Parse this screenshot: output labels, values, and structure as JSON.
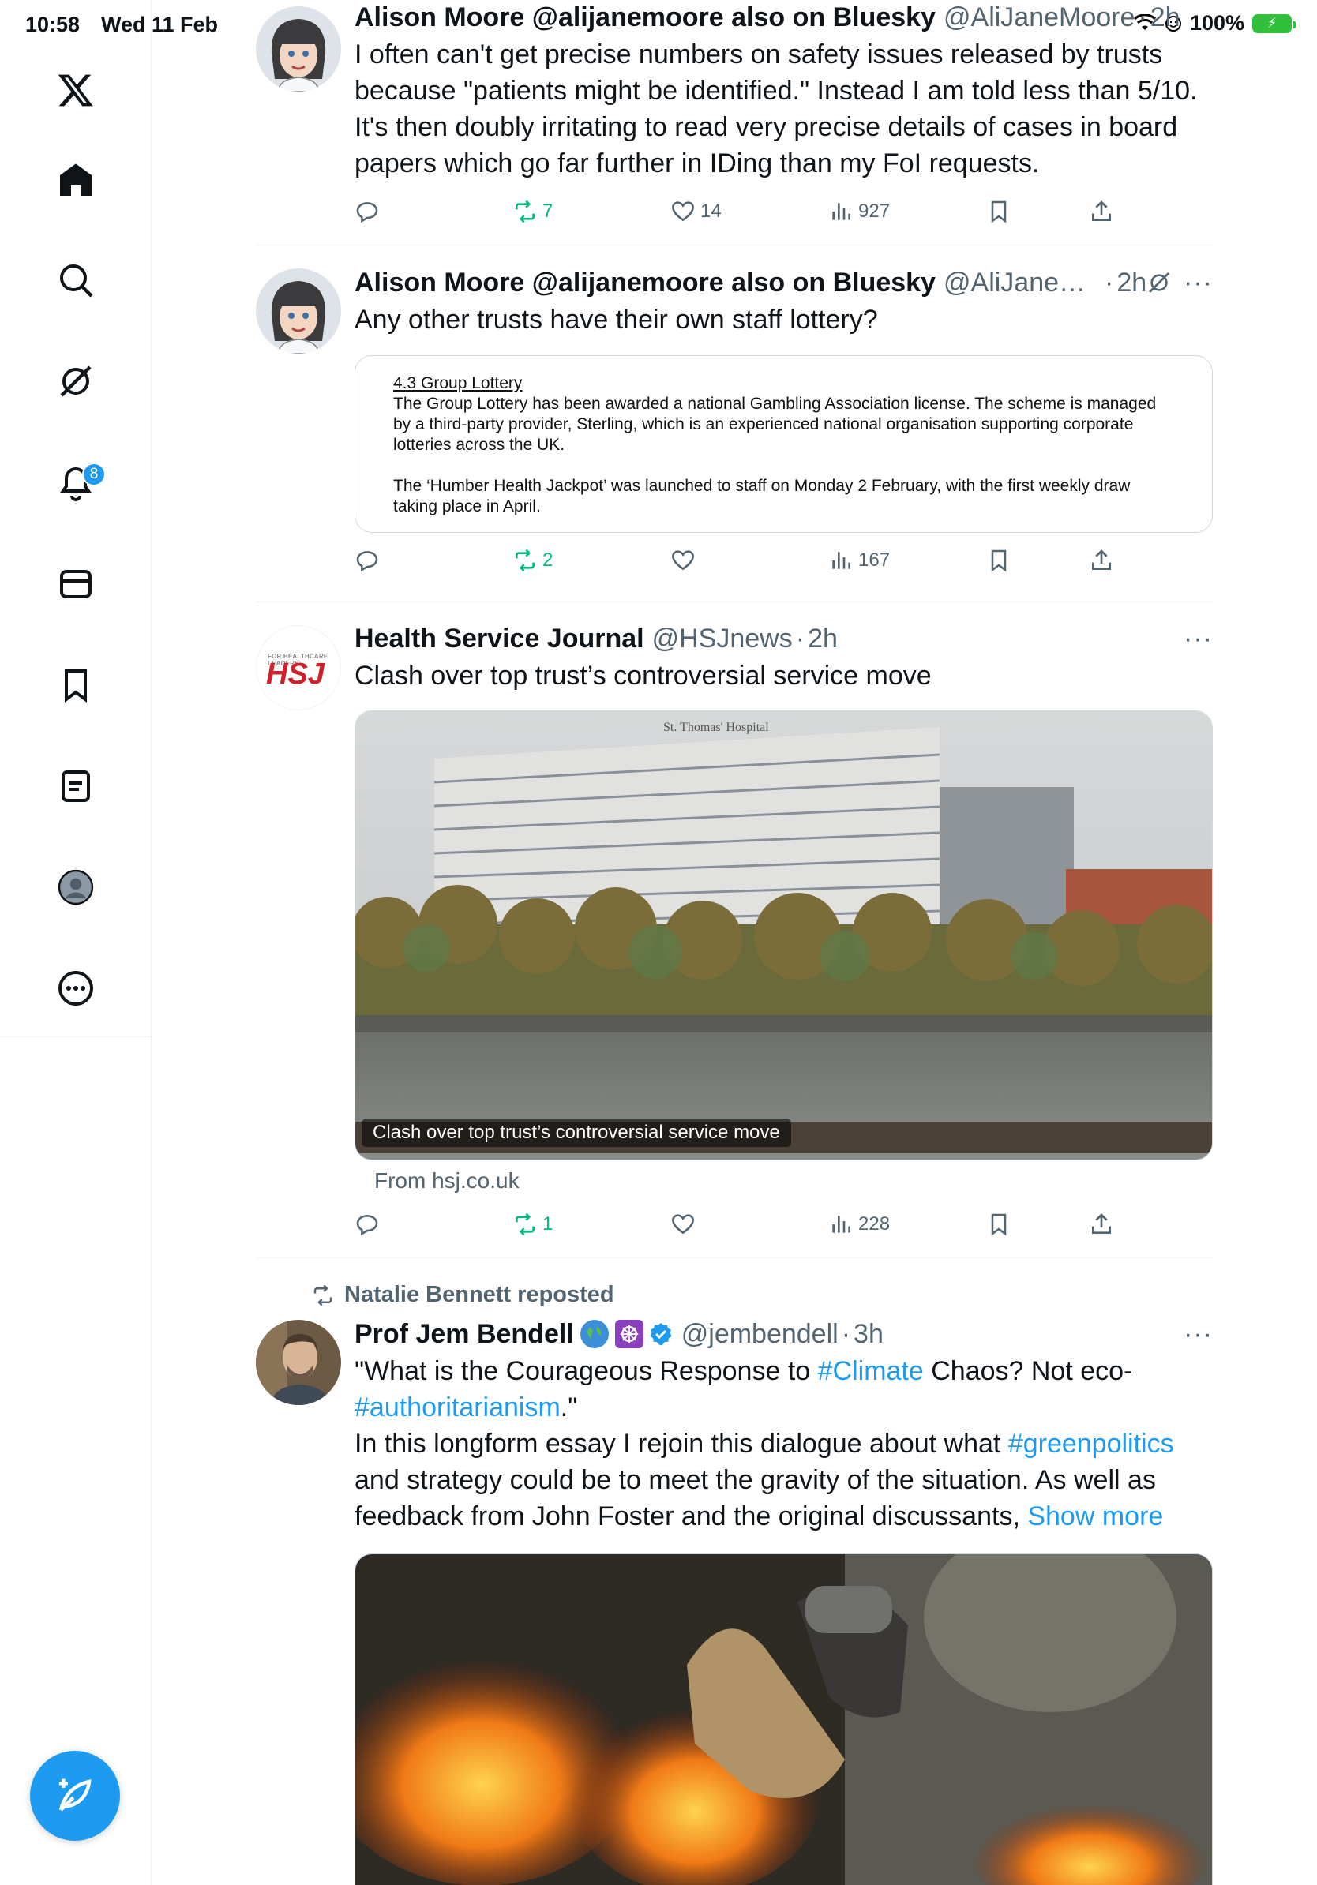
{
  "status": {
    "time": "10:58",
    "date": "Wed 11 Feb",
    "battery": "100%"
  },
  "nav": {
    "items": [
      "X",
      "Home",
      "Search",
      "Grok",
      "Notifications",
      "Messages",
      "Bookmarks",
      "Lists",
      "Profile",
      "More"
    ],
    "notifications_badge": "8"
  },
  "tweets": [
    {
      "name": "Alison Moore @alijanemoore also on Bluesky",
      "handle": "@AliJaneMoore",
      "time": "2h",
      "text": "I often can't get precise numbers on safety issues released by trusts because \"patients might be identified.\" Instead I am told less than 5/10. It's then doubly irritating to read very precise details of cases in board papers which go far further in IDing than my FoI requests.",
      "reposts": "7",
      "likes": "14",
      "views": "927"
    },
    {
      "name": "Alison Moore @alijanemoore also on Bluesky",
      "handle": "@AliJaneM...",
      "time": "2h",
      "text": "Any other trusts have their own staff lottery?",
      "doc": {
        "heading": "4.3 Group Lottery",
        "para1": "The Group Lottery has been awarded a national Gambling Association license. The scheme is managed by a third-party provider, Sterling, which is an experienced national organisation supporting corporate lotteries across the UK.",
        "para2": "The ‘Humber Health Jackpot’ was launched to staff on Monday 2 February, with the first weekly draw taking place in April."
      },
      "reposts": "2",
      "likes": "",
      "views": "167"
    },
    {
      "name": "Health Service Journal",
      "handle": "@HSJnews",
      "time": "2h",
      "text": "Clash over top trust’s controversial service move",
      "logo": "HSJ",
      "logo_small": "FOR HEALTHCARE LEADERS",
      "image_sign": "St. Thomas' Hospital",
      "card_caption": "Clash over top trust’s controversial service move",
      "from": "From hsj.co.uk",
      "reposts": "1",
      "likes": "",
      "views": "228"
    },
    {
      "reposted_by": "Natalie Bennett reposted",
      "name": "Prof Jem Bendell",
      "handle": "@jembendell",
      "time": "3h",
      "text_parts": {
        "p1": "\"What is the Courageous Response to ",
        "tag1": "#Climate",
        "p2": " Chaos? Not eco-",
        "tag2": "#authoritarianism",
        "p3": ".\"",
        "p4": "In this longform essay I rejoin this dialogue about what ",
        "tag3": "#greenpolitics",
        "p5": " and strategy could be to meet the gravity of the situation. As well as feedback from John Foster and the original discussants, ",
        "show_more": "Show more"
      }
    }
  ],
  "colors": {
    "accent": "#1d9bf0",
    "repost": "#00ba7c",
    "muted": "#536471"
  }
}
